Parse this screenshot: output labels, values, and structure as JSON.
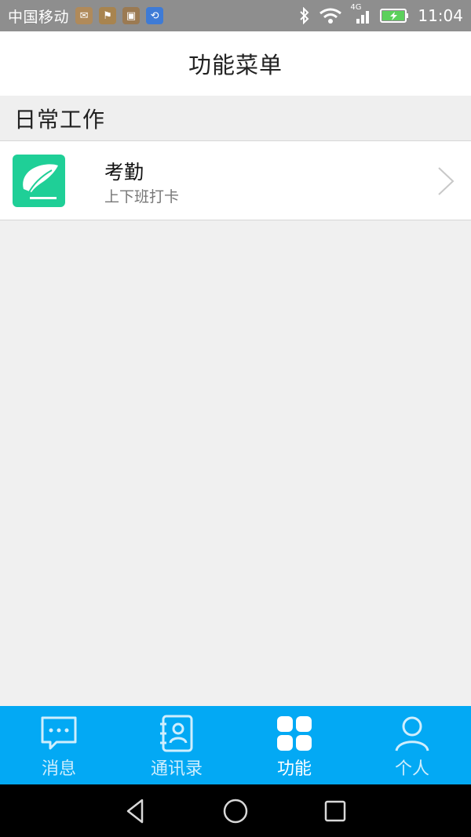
{
  "status_bar": {
    "carrier": "中国移动",
    "network": "4G",
    "time": "11:04"
  },
  "header": {
    "title": "功能菜单"
  },
  "sections": [
    {
      "title": "日常工作",
      "items": [
        {
          "title": "考勤",
          "subtitle": "上下班打卡",
          "icon": "feather-icon",
          "icon_color": "#1fcf97"
        }
      ]
    }
  ],
  "tabs": [
    {
      "label": "消息",
      "icon": "message-icon",
      "active": false
    },
    {
      "label": "通讯录",
      "icon": "contacts-icon",
      "active": false
    },
    {
      "label": "功能",
      "icon": "grid-icon",
      "active": true
    },
    {
      "label": "个人",
      "icon": "person-icon",
      "active": false
    }
  ],
  "colors": {
    "tabbar": "#03a9f4",
    "status_bar": "#8e8e8e",
    "accent_green": "#1fcf97"
  }
}
